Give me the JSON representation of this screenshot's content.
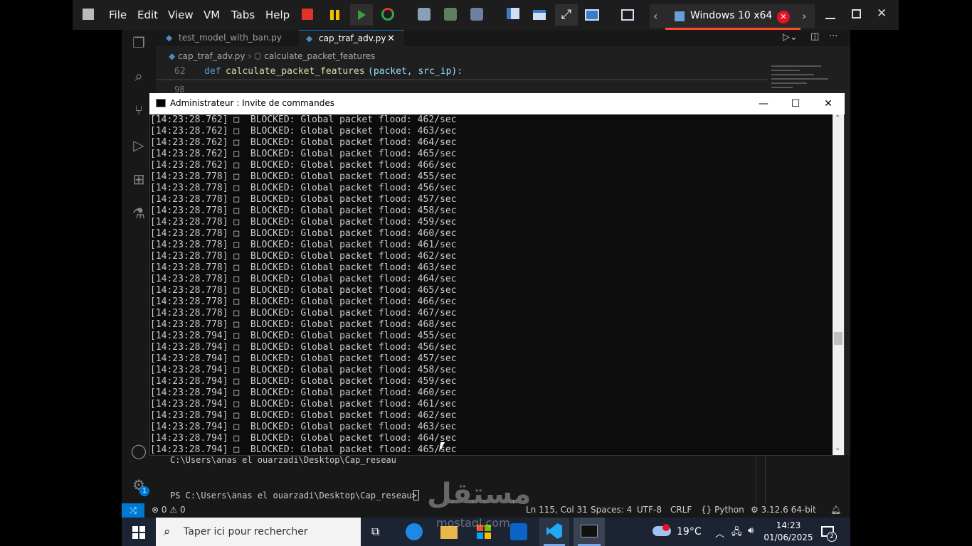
{
  "vmware": {
    "menu": [
      "File",
      "Edit",
      "View",
      "VM",
      "Tabs",
      "Help"
    ],
    "tab_title": "Windows 10 x64"
  },
  "vscode": {
    "tabs": [
      {
        "label": "test_model_with_ban.py"
      },
      {
        "label": "cap_traf_adv.py"
      }
    ],
    "breadcrumb": {
      "file": "cap_traf_adv.py",
      "symbol": "calculate_packet_features"
    },
    "code": {
      "line_number": "62",
      "keyword": "def",
      "function": "calculate_packet_features",
      "params": "(packet, src_ip):",
      "next_line_number": "98"
    },
    "terminal": {
      "path_line": "C:\\Users\\anas el ouarzadi\\Desktop\\Cap_reseau",
      "prompt": "PS C:\\Users\\anas el ouarzadi\\Desktop\\Cap_reseau> "
    },
    "status": {
      "errors": "0",
      "warnings": "0",
      "position": "Ln 115, Col 31",
      "spaces": "Spaces: 4",
      "encoding": "UTF-8",
      "eol": "CRLF",
      "language": "Python",
      "interpreter": "3.12.6 64-bit"
    },
    "settings_badge": "1"
  },
  "cmd": {
    "title": "Administrateur : Invite de commandes",
    "lines": [
      "[14:23:28.762] □  BLOCKED: Global packet flood: 462/sec",
      "[14:23:28.762] □  BLOCKED: Global packet flood: 463/sec",
      "[14:23:28.762] □  BLOCKED: Global packet flood: 464/sec",
      "[14:23:28.762] □  BLOCKED: Global packet flood: 465/sec",
      "[14:23:28.762] □  BLOCKED: Global packet flood: 466/sec",
      "[14:23:28.778] □  BLOCKED: Global packet flood: 455/sec",
      "[14:23:28.778] □  BLOCKED: Global packet flood: 456/sec",
      "[14:23:28.778] □  BLOCKED: Global packet flood: 457/sec",
      "[14:23:28.778] □  BLOCKED: Global packet flood: 458/sec",
      "[14:23:28.778] □  BLOCKED: Global packet flood: 459/sec",
      "[14:23:28.778] □  BLOCKED: Global packet flood: 460/sec",
      "[14:23:28.778] □  BLOCKED: Global packet flood: 461/sec",
      "[14:23:28.778] □  BLOCKED: Global packet flood: 462/sec",
      "[14:23:28.778] □  BLOCKED: Global packet flood: 463/sec",
      "[14:23:28.778] □  BLOCKED: Global packet flood: 464/sec",
      "[14:23:28.778] □  BLOCKED: Global packet flood: 465/sec",
      "[14:23:28.778] □  BLOCKED: Global packet flood: 466/sec",
      "[14:23:28.778] □  BLOCKED: Global packet flood: 467/sec",
      "[14:23:28.778] □  BLOCKED: Global packet flood: 468/sec",
      "[14:23:28.794] □  BLOCKED: Global packet flood: 455/sec",
      "[14:23:28.794] □  BLOCKED: Global packet flood: 456/sec",
      "[14:23:28.794] □  BLOCKED: Global packet flood: 457/sec",
      "[14:23:28.794] □  BLOCKED: Global packet flood: 458/sec",
      "[14:23:28.794] □  BLOCKED: Global packet flood: 459/sec",
      "[14:23:28.794] □  BLOCKED: Global packet flood: 460/sec",
      "[14:23:28.794] □  BLOCKED: Global packet flood: 461/sec",
      "[14:23:28.794] □  BLOCKED: Global packet flood: 462/sec",
      "[14:23:28.794] □  BLOCKED: Global packet flood: 463/sec",
      "[14:23:28.794] □  BLOCKED: Global packet flood: 464/sec",
      "[14:23:28.794] □  BLOCKED: Global packet flood: 465/sec"
    ]
  },
  "taskbar": {
    "search_placeholder": "Taper ici pour rechercher",
    "weather_temp": "19°C",
    "time": "14:23",
    "date": "01/06/2025",
    "notification_count": "2"
  },
  "watermark": {
    "text": "مستقل",
    "sub": "mostaql.com"
  },
  "colors": {
    "accent": "#0078d4",
    "vm_tab_underline": "#ff4b2b",
    "cmd_bg": "#0c0c0c"
  }
}
